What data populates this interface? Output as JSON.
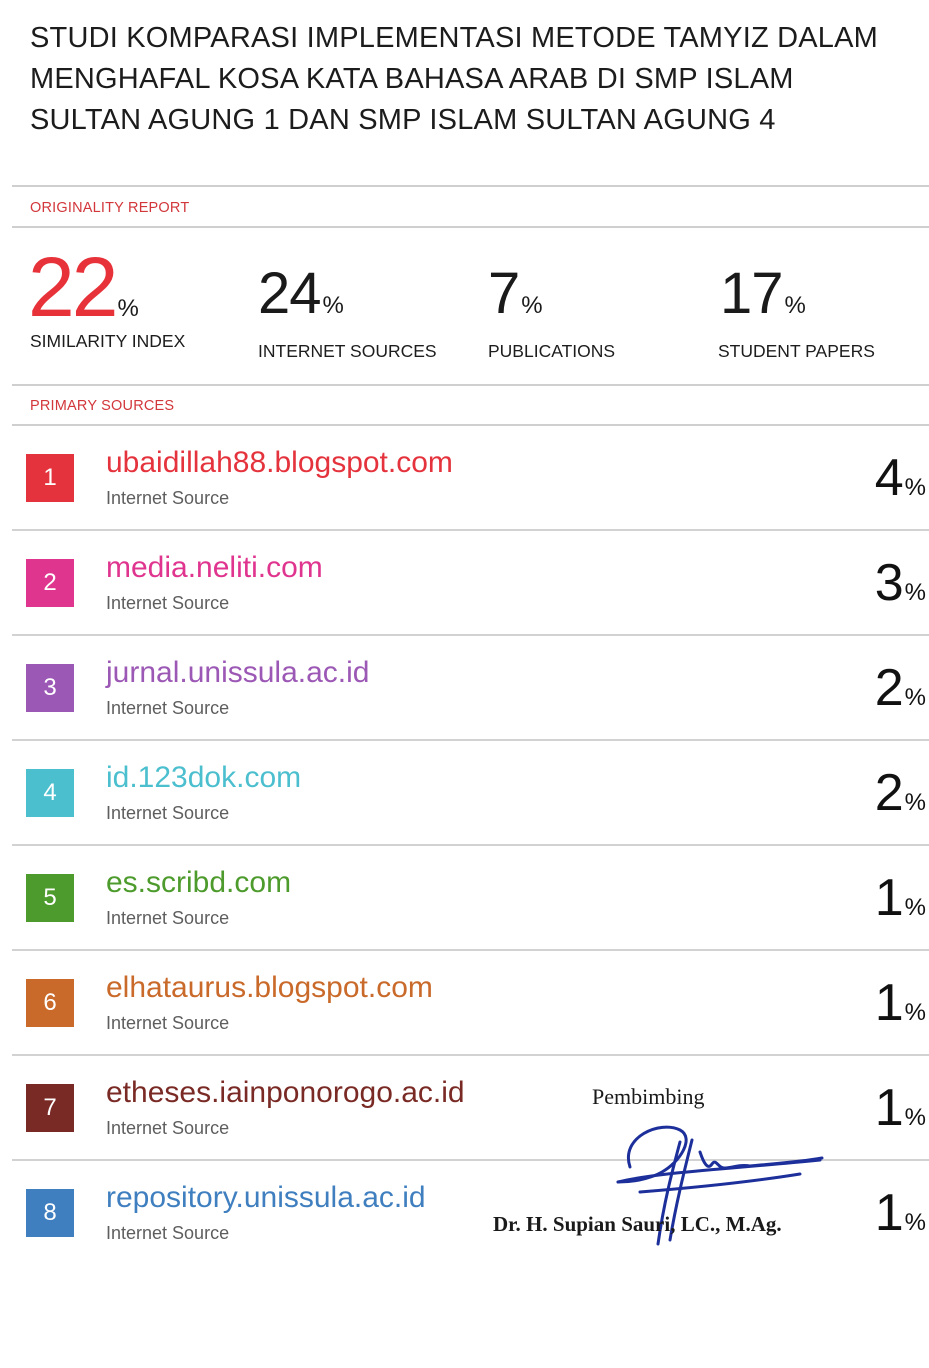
{
  "title": "STUDI KOMPARASI IMPLEMENTASI METODE TAMYIZ DALAM MENGHAFAL KOSA KATA BAHASA ARAB DI SMP ISLAM SULTAN AGUNG 1 DAN SMP ISLAM SULTAN AGUNG 4",
  "originality_label": "ORIGINALITY REPORT",
  "stats": [
    {
      "value": "22",
      "unit": "%",
      "label": "SIMILARITY INDEX"
    },
    {
      "value": "24",
      "unit": "%",
      "label": "INTERNET SOURCES"
    },
    {
      "value": "7",
      "unit": "%",
      "label": "PUBLICATIONS"
    },
    {
      "value": "17",
      "unit": "%",
      "label": "STUDENT PAPERS"
    }
  ],
  "primary_label": "PRIMARY SOURCES",
  "sources": [
    {
      "rank": "1",
      "name": "ubaidillah88.blogspot.com",
      "type": "Internet Source",
      "value": "4",
      "unit": "%",
      "color": "#e5333d"
    },
    {
      "rank": "2",
      "name": "media.neliti.com",
      "type": "Internet Source",
      "value": "3",
      "unit": "%",
      "color": "#e0358f"
    },
    {
      "rank": "3",
      "name": "jurnal.unissula.ac.id",
      "type": "Internet Source",
      "value": "2",
      "unit": "%",
      "color": "#9c58b5"
    },
    {
      "rank": "4",
      "name": "id.123dok.com",
      "type": "Internet Source",
      "value": "2",
      "unit": "%",
      "color": "#4cbfcf"
    },
    {
      "rank": "5",
      "name": "es.scribd.com",
      "type": "Internet Source",
      "value": "1",
      "unit": "%",
      "color": "#4e9b2d"
    },
    {
      "rank": "6",
      "name": "elhataurus.blogspot.com",
      "type": "Internet Source",
      "value": "1",
      "unit": "%",
      "color": "#c96a2a"
    },
    {
      "rank": "7",
      "name": "etheses.iainponorogo.ac.id",
      "type": "Internet Source",
      "value": "1",
      "unit": "%",
      "color": "#7a2a25"
    },
    {
      "rank": "8",
      "name": "repository.unissula.ac.id",
      "type": "Internet Source",
      "value": "1",
      "unit": "%",
      "color": "#3f7fbf"
    }
  ],
  "signature": {
    "label": "Pembimbing",
    "name": "Dr. H. Supian Sauri, LC., M.Ag.",
    "ink_color": "#1d2f9a"
  }
}
